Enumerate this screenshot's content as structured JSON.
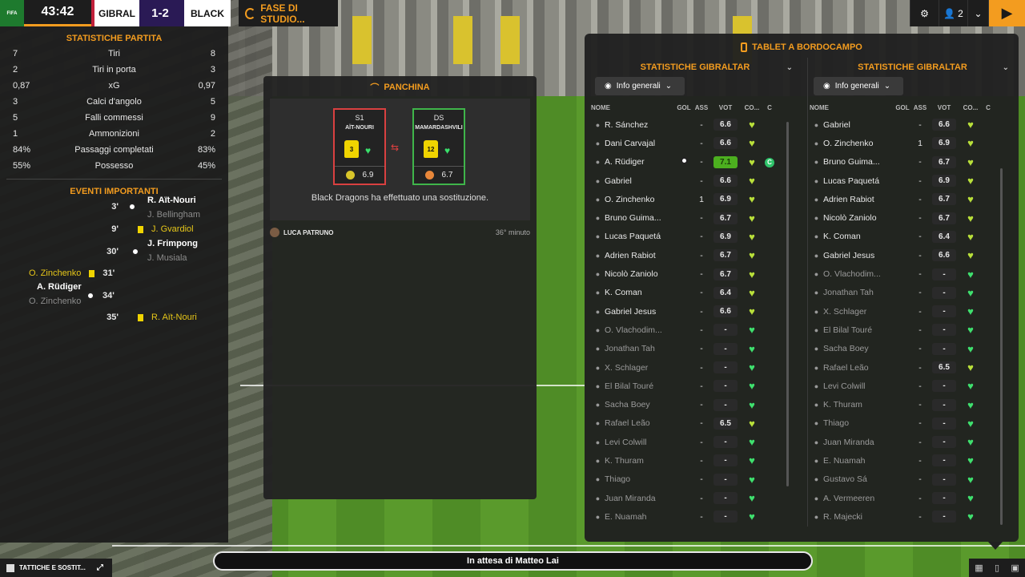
{
  "scoreboard": {
    "badge": "FIFA",
    "clock": "43:42",
    "home": "GIBRAL",
    "score": "1-2",
    "away": "BLACK",
    "phase": "FASE DI STUDIO..."
  },
  "topright": {
    "settings_icon": "gear-icon",
    "users_count": "2",
    "chevron": "chevron-down-icon",
    "play_icon": "play-icon"
  },
  "match_stats": {
    "title": "STATISTICHE PARTITA",
    "rows": [
      {
        "left": "7",
        "label": "Tiri",
        "right": "8"
      },
      {
        "left": "2",
        "label": "Tiri in porta",
        "right": "3"
      },
      {
        "left": "0,87",
        "label": "xG",
        "right": "0,97"
      },
      {
        "left": "3",
        "label": "Calci d'angolo",
        "right": "5"
      },
      {
        "left": "5",
        "label": "Falli commessi",
        "right": "9"
      },
      {
        "left": "1",
        "label": "Ammonizioni",
        "right": "2"
      },
      {
        "left": "84%",
        "label": "Passaggi completati",
        "right": "83%"
      },
      {
        "left": "55%",
        "label": "Possesso",
        "right": "45%"
      }
    ]
  },
  "events": {
    "title": "EVENTI IMPORTANTI",
    "items": [
      {
        "minute": "3'",
        "side": "away",
        "type": "goal",
        "main": "R. Aït-Nouri",
        "assist": "J. Bellingham"
      },
      {
        "minute": "9'",
        "side": "away",
        "type": "yellow",
        "main": "J. Gvardiol"
      },
      {
        "minute": "30'",
        "side": "away",
        "type": "goal",
        "main": "J. Frimpong",
        "assist": "J. Musiala"
      },
      {
        "minute": "31'",
        "side": "home",
        "type": "yellow",
        "main": "O. Zinchenko"
      },
      {
        "minute": "34'",
        "side": "home",
        "type": "goal",
        "main": "A. Rüdiger",
        "assist": "O. Zinchenko"
      },
      {
        "minute": "35'",
        "side": "away",
        "type": "yellow",
        "main": "R. Aït-Nouri"
      }
    ]
  },
  "bench": {
    "title": "PANCHINA",
    "out_player": {
      "pos": "S1",
      "name": "AÏT-NOURI",
      "number": "3",
      "rating": "6.9"
    },
    "in_player": {
      "pos": "DS",
      "name": "MAMARDASHVILI",
      "number": "12",
      "rating": "6.7"
    },
    "message": "Black Dragons ha effettuato una sostituzione.",
    "coach": "LUCA PATRUNO",
    "coach_time": "36° minuto"
  },
  "tablet": {
    "title": "TABLET A BORDOCAMPO",
    "headers": {
      "name": "NOME",
      "gol": "GOL",
      "ass": "ASS",
      "vot": "VOT",
      "co": "CO...",
      "c": "C"
    },
    "left": {
      "title": "STATISTICHE GIBRALTAR",
      "filter": "Info generali",
      "players": [
        {
          "name": "R. Sánchez",
          "gol": "",
          "ass": "-",
          "vot": "6.6",
          "cond": "yel",
          "dim": false
        },
        {
          "name": "Dani Carvajal",
          "gol": "",
          "ass": "-",
          "vot": "6.6",
          "cond": "yel",
          "dim": false
        },
        {
          "name": "A. Rüdiger",
          "gol": "ball",
          "ass": "-",
          "vot": "7.1",
          "cond": "yel",
          "dim": false,
          "highlight": true,
          "captain": "C"
        },
        {
          "name": "Gabriel",
          "gol": "",
          "ass": "-",
          "vot": "6.6",
          "cond": "yel",
          "dim": false
        },
        {
          "name": "O. Zinchenko",
          "gol": "",
          "ass": "1",
          "vot": "6.9",
          "cond": "yel",
          "dim": false
        },
        {
          "name": "Bruno Guima...",
          "gol": "",
          "ass": "-",
          "vot": "6.7",
          "cond": "yel",
          "dim": false
        },
        {
          "name": "Lucas Paquetá",
          "gol": "",
          "ass": "-",
          "vot": "6.9",
          "cond": "yel",
          "dim": false
        },
        {
          "name": "Adrien Rabiot",
          "gol": "",
          "ass": "-",
          "vot": "6.7",
          "cond": "yel",
          "dim": false
        },
        {
          "name": "Nicolò Zaniolo",
          "gol": "",
          "ass": "-",
          "vot": "6.7",
          "cond": "yel",
          "dim": false
        },
        {
          "name": "K. Coman",
          "gol": "",
          "ass": "-",
          "vot": "6.4",
          "cond": "yel",
          "dim": false
        },
        {
          "name": "Gabriel Jesus",
          "gol": "",
          "ass": "-",
          "vot": "6.6",
          "cond": "yel",
          "dim": false
        },
        {
          "name": "O. Vlachodim...",
          "gol": "",
          "ass": "-",
          "vot": "-",
          "cond": "full",
          "dim": true
        },
        {
          "name": "Jonathan Tah",
          "gol": "",
          "ass": "-",
          "vot": "-",
          "cond": "full",
          "dim": true
        },
        {
          "name": "X. Schlager",
          "gol": "",
          "ass": "-",
          "vot": "-",
          "cond": "full",
          "dim": true
        },
        {
          "name": "El Bilal Touré",
          "gol": "",
          "ass": "-",
          "vot": "-",
          "cond": "full",
          "dim": true
        },
        {
          "name": "Sacha Boey",
          "gol": "",
          "ass": "-",
          "vot": "-",
          "cond": "full",
          "dim": true
        },
        {
          "name": "Rafael Leão",
          "gol": "",
          "ass": "-",
          "vot": "6.5",
          "cond": "yel",
          "dim": true
        },
        {
          "name": "Levi Colwill",
          "gol": "",
          "ass": "-",
          "vot": "-",
          "cond": "full",
          "dim": true
        },
        {
          "name": "K. Thuram",
          "gol": "",
          "ass": "-",
          "vot": "-",
          "cond": "full",
          "dim": true
        },
        {
          "name": "Thiago",
          "gol": "",
          "ass": "-",
          "vot": "-",
          "cond": "full",
          "dim": true
        },
        {
          "name": "Juan Miranda",
          "gol": "",
          "ass": "-",
          "vot": "-",
          "cond": "full",
          "dim": true
        },
        {
          "name": "E. Nuamah",
          "gol": "",
          "ass": "-",
          "vot": "-",
          "cond": "full",
          "dim": true
        }
      ]
    },
    "right": {
      "title": "STATISTICHE GIBRALTAR",
      "filter": "Info generali",
      "players": [
        {
          "name": "Gabriel",
          "gol": "",
          "ass": "-",
          "vot": "6.6",
          "cond": "yel",
          "dim": false
        },
        {
          "name": "O. Zinchenko",
          "gol": "",
          "ass": "1",
          "vot": "6.9",
          "cond": "yel",
          "dim": false
        },
        {
          "name": "Bruno Guima...",
          "gol": "",
          "ass": "-",
          "vot": "6.7",
          "cond": "yel",
          "dim": false
        },
        {
          "name": "Lucas Paquetá",
          "gol": "",
          "ass": "-",
          "vot": "6.9",
          "cond": "yel",
          "dim": false
        },
        {
          "name": "Adrien Rabiot",
          "gol": "",
          "ass": "-",
          "vot": "6.7",
          "cond": "yel",
          "dim": false
        },
        {
          "name": "Nicolò Zaniolo",
          "gol": "",
          "ass": "-",
          "vot": "6.7",
          "cond": "yel",
          "dim": false
        },
        {
          "name": "K. Coman",
          "gol": "",
          "ass": "-",
          "vot": "6.4",
          "cond": "yel",
          "dim": false
        },
        {
          "name": "Gabriel Jesus",
          "gol": "",
          "ass": "-",
          "vot": "6.6",
          "cond": "yel",
          "dim": false
        },
        {
          "name": "O. Vlachodim...",
          "gol": "",
          "ass": "-",
          "vot": "-",
          "cond": "full",
          "dim": true
        },
        {
          "name": "Jonathan Tah",
          "gol": "",
          "ass": "-",
          "vot": "-",
          "cond": "full",
          "dim": true
        },
        {
          "name": "X. Schlager",
          "gol": "",
          "ass": "-",
          "vot": "-",
          "cond": "full",
          "dim": true
        },
        {
          "name": "El Bilal Touré",
          "gol": "",
          "ass": "-",
          "vot": "-",
          "cond": "full",
          "dim": true
        },
        {
          "name": "Sacha Boey",
          "gol": "",
          "ass": "-",
          "vot": "-",
          "cond": "full",
          "dim": true
        },
        {
          "name": "Rafael Leão",
          "gol": "",
          "ass": "-",
          "vot": "6.5",
          "cond": "yel",
          "dim": true
        },
        {
          "name": "Levi Colwill",
          "gol": "",
          "ass": "-",
          "vot": "-",
          "cond": "full",
          "dim": true
        },
        {
          "name": "K. Thuram",
          "gol": "",
          "ass": "-",
          "vot": "-",
          "cond": "full",
          "dim": true
        },
        {
          "name": "Thiago",
          "gol": "",
          "ass": "-",
          "vot": "-",
          "cond": "full",
          "dim": true
        },
        {
          "name": "Juan Miranda",
          "gol": "",
          "ass": "-",
          "vot": "-",
          "cond": "full",
          "dim": true
        },
        {
          "name": "E. Nuamah",
          "gol": "",
          "ass": "-",
          "vot": "-",
          "cond": "full",
          "dim": true
        },
        {
          "name": "Gustavo Sá",
          "gol": "",
          "ass": "-",
          "vot": "-",
          "cond": "full",
          "dim": true
        },
        {
          "name": "A. Vermeeren",
          "gol": "",
          "ass": "-",
          "vot": "-",
          "cond": "full",
          "dim": true
        },
        {
          "name": "R. Majecki",
          "gol": "",
          "ass": "-",
          "vot": "-",
          "cond": "full",
          "dim": true
        }
      ]
    }
  },
  "status": "In attesa di Matteo Lai",
  "bottom_left": {
    "label": "TATTICHE E SOSTIT...",
    "icon": "expand-icon"
  },
  "colors": {
    "accent": "#f39c1f",
    "home": "#c0203a",
    "away": "#2a1a55",
    "condition_full": "#3fe06e",
    "condition_mid": "#b9e03a"
  }
}
